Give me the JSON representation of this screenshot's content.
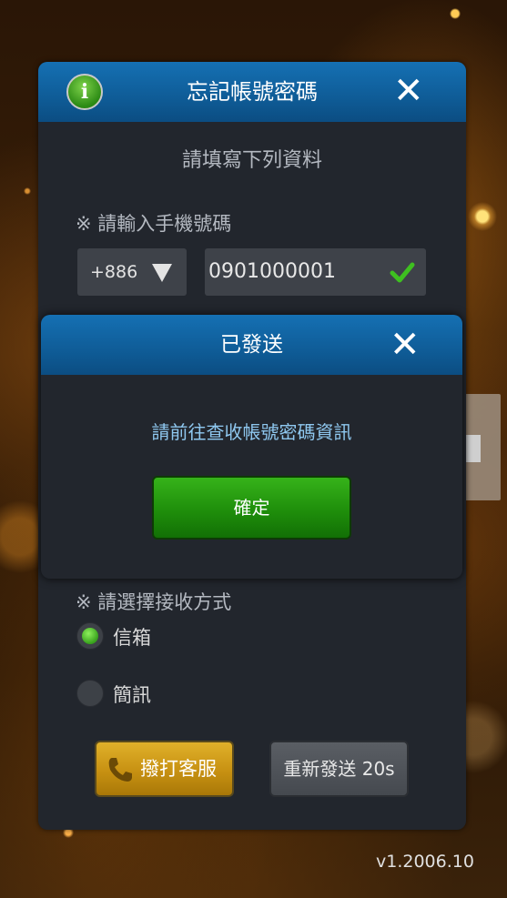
{
  "forgot_dialog": {
    "title": "忘記帳號密碼",
    "info_icon": "info-icon",
    "close_icon": "close-icon",
    "subtitle": "請填寫下列資料",
    "phone_label": "※ 請輸入手機號碼",
    "country_code": "+886",
    "phone_value": "0901000001",
    "method_label": "※ 請選擇接收方式",
    "options": [
      {
        "label": "信箱",
        "selected": true
      },
      {
        "label": "簡訊",
        "selected": false
      }
    ],
    "call_button": "撥打客服",
    "resend_button": "重新發送 20s"
  },
  "alert": {
    "title": "已發送",
    "message": "請前往查收帳號密碼資訊",
    "ok_button": "確定"
  },
  "version": "v1.2006.10",
  "obscured_button_text": "t",
  "colors": {
    "header_blue": "#0f5c97",
    "dialog_bg": "#22262d",
    "ok_green": "#1f8e0b",
    "call_gold": "#c79112",
    "message_blue": "#8fc8f0"
  }
}
